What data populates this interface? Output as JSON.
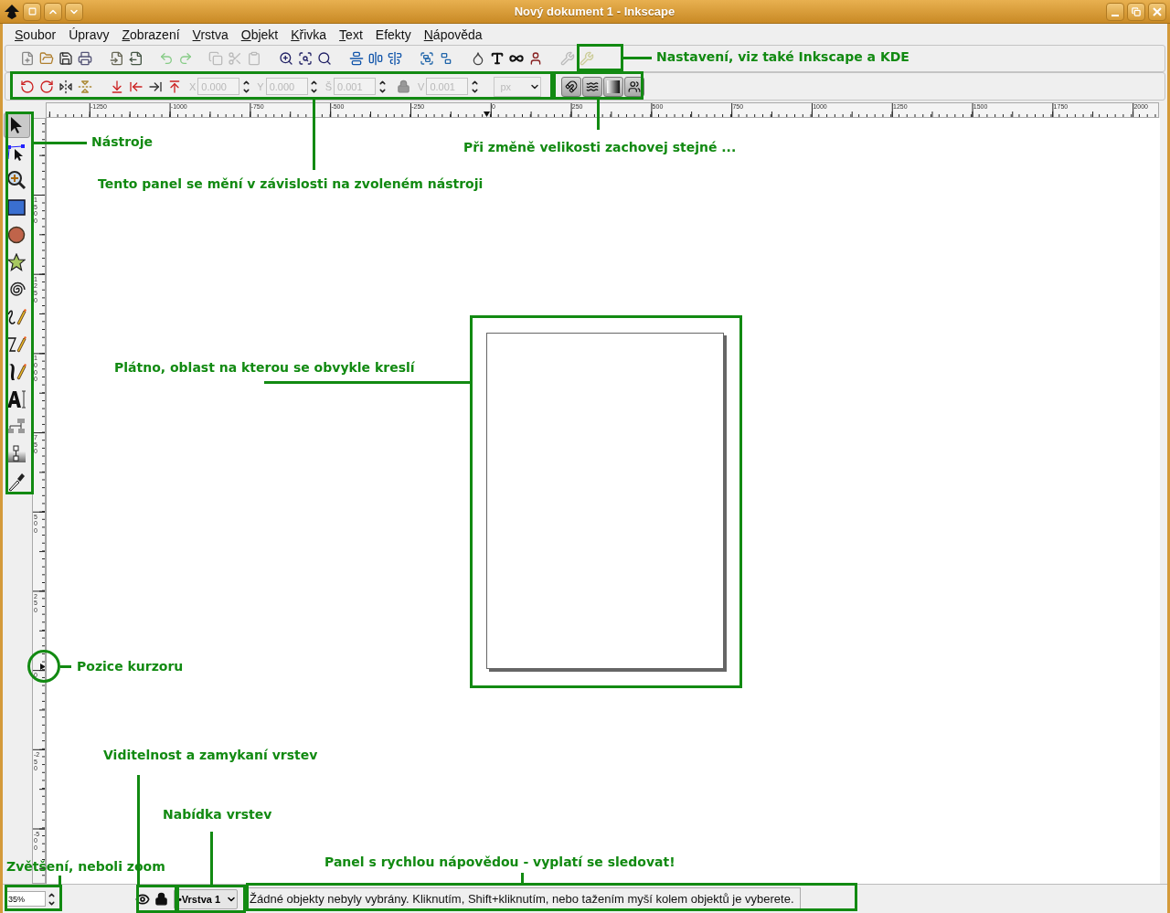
{
  "window": {
    "title": "Nový dokument 1 - Inkscape"
  },
  "menu": [
    {
      "label": "Soubor",
      "mnemonic": true
    },
    {
      "label": "Úpravy",
      "mnemonic": false
    },
    {
      "label": "Zobrazení",
      "mnemonic": true
    },
    {
      "label": "Vrstva",
      "mnemonic": true
    },
    {
      "label": "Objekt",
      "mnemonic": true
    },
    {
      "label": "Křivka",
      "mnemonic": true
    },
    {
      "label": "Text",
      "mnemonic": true
    },
    {
      "label": "Efekty",
      "mnemonic": false
    },
    {
      "label": "Nápověda",
      "mnemonic": true
    }
  ],
  "tool_controls": {
    "fields": [
      {
        "label": "X",
        "value": "0.000",
        "disabled": true
      },
      {
        "label": "Y",
        "value": "0.000",
        "disabled": true
      },
      {
        "label": "Š",
        "value": "0.001",
        "disabled": true
      },
      {
        "label": "V",
        "value": "0.001",
        "disabled": true
      }
    ],
    "unit": "px"
  },
  "toolbox": [
    {
      "selected": true
    },
    {
      "selected": false
    },
    {
      "selected": false
    },
    {
      "selected": false
    },
    {
      "selected": false
    },
    {
      "selected": false
    },
    {
      "selected": false
    },
    {
      "selected": false
    },
    {
      "selected": false
    },
    {
      "selected": false
    },
    {
      "selected": false
    },
    {
      "selected": false
    },
    {
      "selected": false
    },
    {
      "selected": false
    }
  ],
  "horizontal_ruler": [
    "-1250",
    "-1000",
    "-750",
    "-500",
    "-250",
    "0",
    "250",
    "500",
    "750",
    "1000",
    "1250",
    "1500",
    "1750",
    "2000"
  ],
  "vertical_ruler": [
    "1500",
    "1250",
    "1000",
    "750",
    "500",
    "250",
    "0",
    "-250",
    "-500"
  ],
  "status_bar": {
    "zoom": "35%",
    "layer": "•Vrstva 1",
    "message": "Žádné objekty nebyly vybrány. Kliknutím, Shift+kliknutím, nebo tažením myší kolem objektů je vyberete."
  },
  "annotations": [
    {
      "kind": "frame",
      "label": "Nastavení, viz také Inkscape a KDE"
    },
    {
      "kind": "frame",
      "label": "Tento panel se mění v závislosti na zvoleném nástroji"
    },
    {
      "kind": "frame",
      "label": "Při změně velikosti zachovej stejné ..."
    },
    {
      "kind": "frame",
      "label": "Nástroje"
    },
    {
      "kind": "frame",
      "label": "Plátno, oblast na kterou se obvykle kreslí"
    },
    {
      "kind": "circle",
      "label": "Pozice kurzoru"
    },
    {
      "kind": "frame",
      "label": "Viditelnost a zamykaní vrstev"
    },
    {
      "kind": "frame",
      "label": "Nabídka vrstev"
    },
    {
      "kind": "frame",
      "label": "Zvětšení, neboli zoom"
    },
    {
      "kind": "frame",
      "label": "Panel s rychlou nápovědou - vyplatí se sledovat!"
    }
  ]
}
